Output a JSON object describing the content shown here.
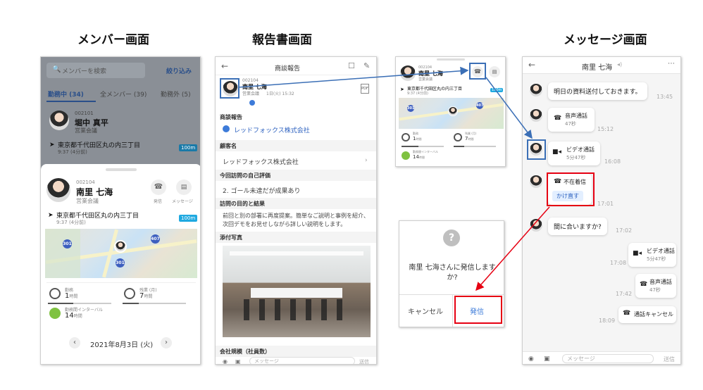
{
  "titles": {
    "member": "メンバー画面",
    "report": "報告書画面",
    "message": "メッセージ画面"
  },
  "member": {
    "search_placeholder": "メンバーを検索",
    "filter": "絞り込み",
    "tabs": [
      "勤務中 (34)",
      "全メンバー (39)",
      "勤務外 (5)"
    ],
    "bg_user": {
      "id": "002101",
      "name": "堀中 真平",
      "dept": "営業会議",
      "address": "東京都千代田区丸の内三丁目",
      "time": "9:37 (4分前)",
      "badge": "100m"
    },
    "card": {
      "id": "002104",
      "name": "南里 七海",
      "dept": "営業会議",
      "call_label": "発信",
      "msg_label": "メッセージ",
      "address": "東京都千代田区丸の内三丁目",
      "time": "9:37 (4分前)",
      "badge": "100m",
      "stats": [
        {
          "label": "勤務",
          "value": "1",
          "unit": "時間"
        },
        {
          "label": "残業 (月)",
          "value": "7",
          "unit": "時間"
        },
        {
          "label": "勤務間インターバル",
          "value": "14",
          "unit": "時間"
        }
      ],
      "date": "2021年8月3日 (火)"
    }
  },
  "report": {
    "header": "商談報告",
    "user": {
      "id": "002104",
      "name": "南里 七海",
      "dept": "営業会議",
      "date": "1日(火) 15:32"
    },
    "section_report": "商談報告",
    "company_link": "レッドフォックス株式会社",
    "customer_label": "顧客名",
    "customer_value": "レッドフォックス株式会社",
    "eval_label": "今回訪問の自己評価",
    "eval_value": "2. ゴール未達だが成果あり",
    "purpose_label": "訪問の目的と結果",
    "purpose_value": "前回と別の部署に再度提案。簡単なご説明と事例を紹介、次回デモをお見せしながら詳しい説明をします。",
    "photo_label": "添付写真",
    "scale_label": "会社規模（社員数）",
    "input_placeholder": "メッセージ",
    "send": "送信"
  },
  "mini": {
    "id": "002104",
    "name": "南里 七海",
    "dept": "営業会議",
    "address": "東京都千代田区丸の内三丁目",
    "time": "9:37 (4分前)",
    "badge": "100m",
    "stats": [
      {
        "label": "勤務",
        "value": "1",
        "unit": "時間"
      },
      {
        "label": "残業 (月)",
        "value": "7",
        "unit": "時間"
      },
      {
        "label": "勤務間インターバル",
        "value": "14",
        "unit": "時間"
      }
    ]
  },
  "dialog": {
    "text": "南里 七海さんに発信しますか?",
    "cancel": "キャンセル",
    "call": "発信"
  },
  "message": {
    "header": "南里 七海",
    "msgs": [
      {
        "text": "明日の資料送付しておきます。",
        "time": "13:45"
      },
      {
        "text": "音声通話",
        "sub": "47秒",
        "time": "15:12"
      },
      {
        "text": "ビデオ通話",
        "sub": "5分47秒",
        "time": "16:08"
      },
      {
        "text": "不在着信",
        "sub": "かけ直す",
        "time": "17:01"
      },
      {
        "text": "間に合いますか?",
        "time": "17:02"
      },
      {
        "text": "ビデオ通話",
        "sub": "5分47秒",
        "time": "17:08"
      },
      {
        "text": "音声通話",
        "sub": "47秒",
        "time": "17:42"
      },
      {
        "text": "通話キャンセル",
        "time": "18:09"
      }
    ],
    "input_placeholder": "メッセージ",
    "send": "送信"
  },
  "colors": {
    "accent": "#3d7bd9",
    "badge": "#1fa9e0",
    "red": "#e60012",
    "blue_frame": "#3b6fb6"
  }
}
